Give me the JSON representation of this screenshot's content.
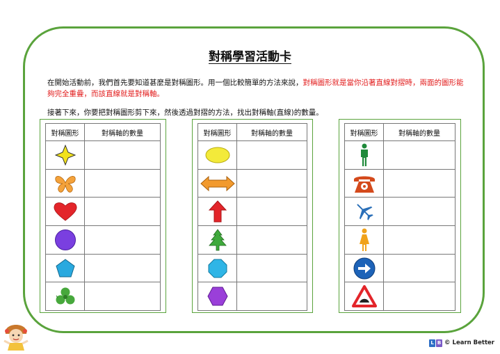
{
  "title": "對稱學習活動卡",
  "intro": {
    "normal": "在開始活動前，我們首先要知道甚麼是對稱圖形。用一個比較簡單的方法來說，",
    "highlight": "對稱圖形就是當你沿著直線對摺時，兩面的圖形能夠完全重疊，而該直線就是對稱軸。"
  },
  "instruction": "接著下來，你要把對稱圖形剪下來，然後透過對摺的方法，找出對稱軸(直線)的數量。",
  "table_headers": {
    "shape": "對稱圖形",
    "count": "對稱軸的數量"
  },
  "tables": [
    {
      "shapes": [
        {
          "icon": "four-point-star-icon",
          "color": "#f2e21b",
          "count": ""
        },
        {
          "icon": "butterfly-icon",
          "color": "#f4a23b",
          "count": ""
        },
        {
          "icon": "heart-icon",
          "color": "#e3252a",
          "count": ""
        },
        {
          "icon": "circle-icon",
          "color": "#7a3fe0",
          "count": ""
        },
        {
          "icon": "pentagon-icon",
          "color": "#29a9df",
          "count": ""
        },
        {
          "icon": "clover-icon",
          "color": "#47a83c",
          "count": ""
        }
      ]
    },
    {
      "shapes": [
        {
          "icon": "ellipse-icon",
          "color": "#f3ea3a",
          "count": ""
        },
        {
          "icon": "double-arrow-icon",
          "color": "#f29a2e",
          "count": ""
        },
        {
          "icon": "up-arrow-icon",
          "color": "#e3252a",
          "count": ""
        },
        {
          "icon": "tree-icon",
          "color": "#3fa93c",
          "count": ""
        },
        {
          "icon": "octagon-icon",
          "color": "#2fb5e6",
          "count": ""
        },
        {
          "icon": "hexagon-icon",
          "color": "#9a3fd9",
          "count": ""
        }
      ]
    },
    {
      "shapes": [
        {
          "icon": "man-icon",
          "color": "#1f8a3a",
          "count": ""
        },
        {
          "icon": "telephone-icon",
          "color": "#d44a1c",
          "count": ""
        },
        {
          "icon": "airplane-icon",
          "color": "#2a6fb8",
          "count": ""
        },
        {
          "icon": "woman-icon",
          "color": "#f0a21b",
          "count": ""
        },
        {
          "icon": "right-arrow-circle-icon",
          "color": "#1d63b8",
          "count": ""
        },
        {
          "icon": "warning-triangle-icon",
          "color": "#e3252a",
          "count": ""
        }
      ]
    }
  ],
  "footer": {
    "brand": "Learn Better",
    "copyright": "©",
    "badge_letters": [
      "L",
      "B"
    ]
  }
}
